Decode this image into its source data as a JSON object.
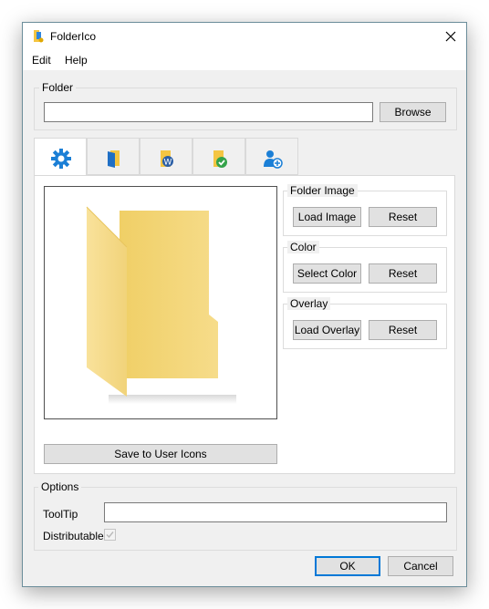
{
  "window": {
    "title": "FolderIco",
    "app_icon": "foldarico-app-icon",
    "close_icon": "close-icon"
  },
  "menu": [
    "Edit",
    "Help"
  ],
  "folder_group": {
    "title": "Folder",
    "path_value": "",
    "browse_label": "Browse"
  },
  "tabs": [
    {
      "icon": "gear-icon",
      "active": true
    },
    {
      "icon": "blue-folder-icon",
      "active": false
    },
    {
      "icon": "wordpress-folder-icon",
      "active": false
    },
    {
      "icon": "checkmark-folder-icon",
      "active": false
    },
    {
      "icon": "user-add-icon",
      "active": false
    }
  ],
  "folder_image_group": {
    "title": "Folder Image",
    "load_label": "Load Image",
    "reset_label": "Reset"
  },
  "color_group": {
    "title": "Color",
    "select_label": "Select Color",
    "reset_label": "Reset"
  },
  "overlay_group": {
    "title": "Overlay",
    "load_label": "Load Overlay",
    "reset_label": "Reset"
  },
  "preview": {
    "icon": "folder-preview-icon"
  },
  "save_label": "Save to User Icons",
  "options_group": {
    "title": "Options",
    "tooltip_label": "ToolTip",
    "tooltip_value": "",
    "distributable_label": "Distributable",
    "distributable_checked": true
  },
  "footer": {
    "ok_label": "OK",
    "cancel_label": "Cancel"
  },
  "colors": {
    "accent": "#0078d7",
    "folder_yellow": "#f4d477",
    "gear_blue": "#1b7fd6"
  }
}
